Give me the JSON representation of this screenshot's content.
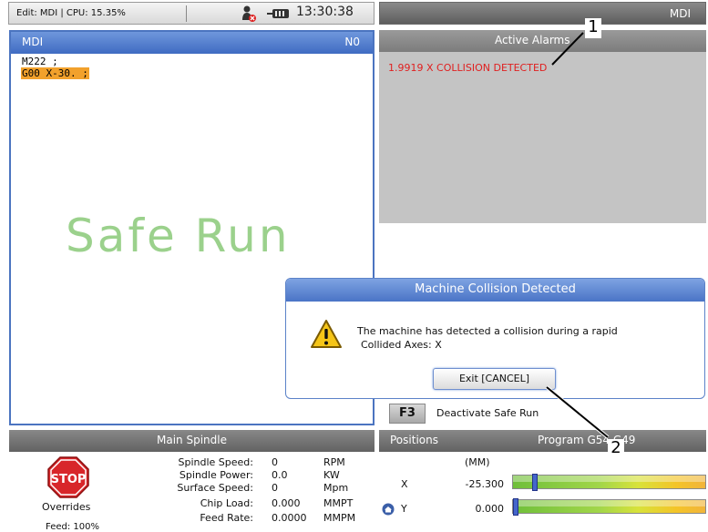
{
  "status_bar": {
    "edit_status": "Edit: MDI | CPU: 15.35%",
    "clock": "13:30:38",
    "mode": "MDI"
  },
  "mdi_panel": {
    "title": "MDI",
    "sequence": "N0",
    "code_lines": [
      "M222 ;",
      "G00 X-30. ;"
    ],
    "watermark": "Safe Run"
  },
  "alarms_panel": {
    "title": "Active Alarms",
    "alarm": "1.9919  X COLLISION DETECTED"
  },
  "dialog": {
    "title": "Machine Collision Detected",
    "message_line1": "The machine has detected a collision during a rapid",
    "message_line2": "Collided Axes: X",
    "exit_label": "Exit [CANCEL]"
  },
  "function_key": {
    "key": "F3",
    "label": "Deactivate Safe Run"
  },
  "spindle_panel": {
    "title": "Main Spindle",
    "stop_label": "STOP",
    "overrides_label": "Overrides",
    "feed_cut": "Feed:  100%",
    "rows": [
      {
        "label": "Spindle Speed:",
        "value": "0",
        "unit": "RPM"
      },
      {
        "label": "Spindle Power:",
        "value": "0.0",
        "unit": "KW"
      },
      {
        "label": "Surface Speed:",
        "value": "0",
        "unit": "Mpm"
      },
      {
        "label": "Chip Load:",
        "value": "0.000",
        "unit": "MMPT"
      },
      {
        "label": "Feed Rate:",
        "value": "0.0000",
        "unit": "MMPM"
      }
    ]
  },
  "positions_panel": {
    "title": "Positions",
    "program_label": "Program G54 G49",
    "units": "(MM)",
    "axes": [
      {
        "axis": "X",
        "value": "-25.300",
        "marker_fraction": 0.1
      },
      {
        "axis": "Y",
        "value": "0.000",
        "marker_fraction": 0.0
      }
    ]
  },
  "callouts": [
    "1",
    "2"
  ],
  "colors": {
    "header_blue": "#4a74c6",
    "alarm_red": "#e02020",
    "highlight_orange": "#f2a12c",
    "safe_run_green": "#9bd18c"
  }
}
